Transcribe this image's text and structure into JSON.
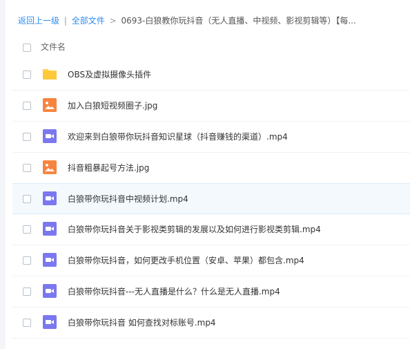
{
  "breadcrumb": {
    "back": "返回上一级",
    "sep1": "|",
    "all_files": "全部文件",
    "sep2": ">",
    "current": "0693-白狼教你玩抖音（无人直播、中视频、影视剪辑等）【每..."
  },
  "list": {
    "header_label": "文件名",
    "files": [
      {
        "name": "OBS及虚拟摄像头插件",
        "icon": "folder-icon"
      },
      {
        "name": "加入白狼短视频圈子.jpg",
        "icon": "image-icon"
      },
      {
        "name": "欢迎来到白狼带你玩抖音知识星球（抖音赚钱的渠道）.mp4",
        "icon": "video-icon"
      },
      {
        "name": "抖音粗暴起号方法.jpg",
        "icon": "image-icon"
      },
      {
        "name": "白狼带你玩抖音中视频计划.mp4",
        "icon": "video-icon"
      },
      {
        "name": "白狼带你玩抖音关于影视类剪辑的发展以及如何进行影视类剪辑.mp4",
        "icon": "video-icon"
      },
      {
        "name": "白狼带你玩抖音，如何更改手机位置（安卓、苹果）都包含.mp4",
        "icon": "video-icon"
      },
      {
        "name": "白狼带你玩抖音---无人直播是什么？什么是无人直播.mp4",
        "icon": "video-icon"
      },
      {
        "name": "白狼带你玩抖音 如何查找对标账号.mp4",
        "icon": "video-icon"
      }
    ]
  },
  "colors": {
    "link": "#2d8cf0",
    "folder": "#ffd04a",
    "image": "#f7843e",
    "video": "#7b77ef",
    "hover_row": "#f3f9fd"
  }
}
